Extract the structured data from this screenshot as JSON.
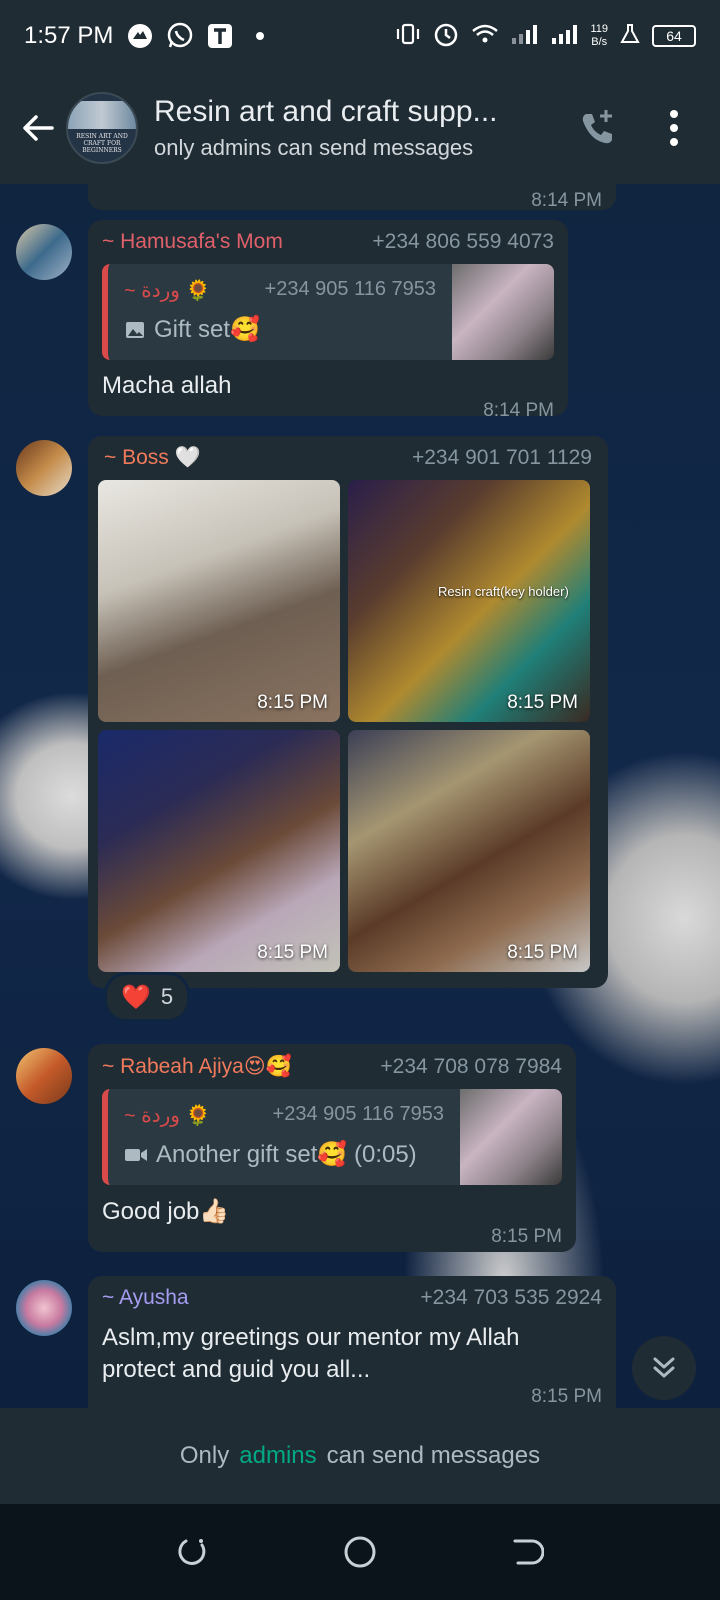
{
  "status_bar": {
    "time": "1:57 PM",
    "net_speed_value": "119",
    "net_speed_unit": "B/s",
    "battery": "64"
  },
  "header": {
    "title": "Resin art and craft supp...",
    "subtitle": "only admins can send messages",
    "avatar_text": "RESIN ART AND CRAFT FOR BEGINNERS"
  },
  "messages": [
    {
      "sender": "~ Hamusafa's Mom",
      "sender_color": "#e0606a",
      "phone": "+234 806 559 4073",
      "quote": {
        "name": "~ وردة 🌻",
        "phone": "+234 905 116 7953",
        "text": "Gift set🥰",
        "media_icon": "image-icon"
      },
      "text": "Macha allah",
      "time": "8:14 PM"
    },
    {
      "sender": "~ Boss 🤍",
      "sender_color": "#f07a5a",
      "phone": "+234 901 701 1129",
      "photos": [
        {
          "time": "8:15 PM"
        },
        {
          "time": "8:15 PM",
          "overlay": "Resin craft(key holder)"
        },
        {
          "time": "8:15 PM"
        },
        {
          "time": "8:15 PM"
        }
      ],
      "reaction": {
        "emoji": "❤️",
        "count": "5"
      }
    },
    {
      "sender": "~ Rabeah Ajiya😍🥰",
      "sender_color": "#f07a5a",
      "phone": "+234 708 078 7984",
      "quote": {
        "name": "~ وردة 🌻",
        "phone": "+234 905 116 7953",
        "text": "Another gift set🥰 (0:05)",
        "media_icon": "video-icon"
      },
      "text": "Good job👍🏻",
      "time": "8:15 PM"
    },
    {
      "sender": "~ Ayusha",
      "sender_color": "#a59cf2",
      "phone": "+234 703 535 2924",
      "text": "Aslm,my greetings our mentor my Allah protect and guid you all...",
      "time": "8:15 PM"
    }
  ],
  "top_partial": {
    "time": "8:14 PM"
  },
  "footer": {
    "prefix": "Only",
    "link": "admins",
    "suffix": "can send messages"
  }
}
